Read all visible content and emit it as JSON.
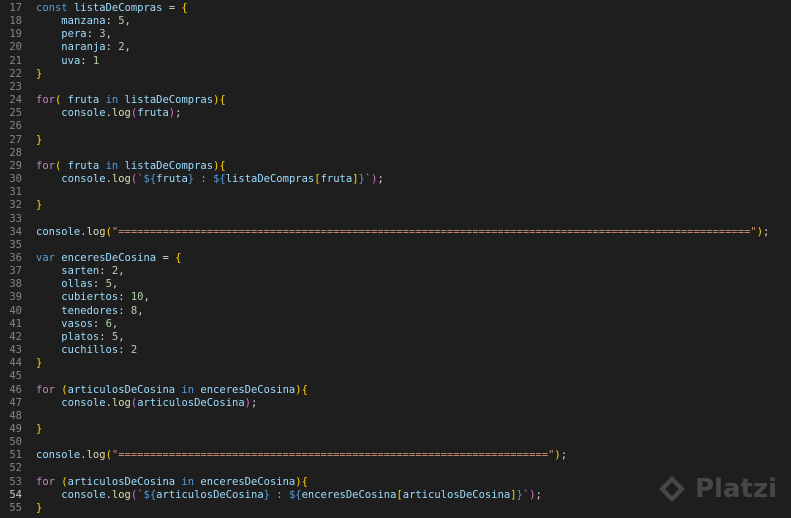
{
  "editor": {
    "active_line": 54,
    "lines": [
      {
        "n": "17",
        "tokens": [
          [
            "k-blue",
            "const "
          ],
          [
            "var",
            "listaDeCompras"
          ],
          [
            "plain",
            " = "
          ],
          [
            "b1",
            "{"
          ]
        ]
      },
      {
        "n": "18",
        "tokens": [
          [
            "plain",
            "    "
          ],
          [
            "var",
            "manzana"
          ],
          [
            "plain",
            ": "
          ],
          [
            "num",
            "5"
          ],
          [
            "plain",
            ","
          ]
        ]
      },
      {
        "n": "19",
        "tokens": [
          [
            "plain",
            "    "
          ],
          [
            "var",
            "pera"
          ],
          [
            "plain",
            ": "
          ],
          [
            "num",
            "3"
          ],
          [
            "plain",
            ","
          ]
        ]
      },
      {
        "n": "20",
        "tokens": [
          [
            "plain",
            "    "
          ],
          [
            "var",
            "naranja"
          ],
          [
            "plain",
            ": "
          ],
          [
            "num",
            "2"
          ],
          [
            "plain",
            ","
          ]
        ]
      },
      {
        "n": "21",
        "tokens": [
          [
            "plain",
            "    "
          ],
          [
            "var",
            "uva"
          ],
          [
            "plain",
            ": "
          ],
          [
            "num",
            "1"
          ]
        ]
      },
      {
        "n": "22",
        "tokens": [
          [
            "b1",
            "}"
          ]
        ]
      },
      {
        "n": "23",
        "tokens": []
      },
      {
        "n": "24",
        "tokens": [
          [
            "k-pur",
            "for"
          ],
          [
            "b1",
            "("
          ],
          [
            "plain",
            " "
          ],
          [
            "var",
            "fruta"
          ],
          [
            "plain",
            " "
          ],
          [
            "k-blue",
            "in"
          ],
          [
            "plain",
            " "
          ],
          [
            "var",
            "listaDeCompras"
          ],
          [
            "b1",
            ")"
          ],
          [
            "b1",
            "{"
          ]
        ]
      },
      {
        "n": "25",
        "tokens": [
          [
            "plain",
            "    "
          ],
          [
            "var",
            "console"
          ],
          [
            "plain",
            "."
          ],
          [
            "fn",
            "log"
          ],
          [
            "b2",
            "("
          ],
          [
            "var",
            "fruta"
          ],
          [
            "b2",
            ")"
          ],
          [
            "plain",
            ";"
          ]
        ]
      },
      {
        "n": "26",
        "tokens": []
      },
      {
        "n": "27",
        "tokens": [
          [
            "b1",
            "}"
          ]
        ]
      },
      {
        "n": "28",
        "tokens": []
      },
      {
        "n": "29",
        "tokens": [
          [
            "k-pur",
            "for"
          ],
          [
            "b1",
            "("
          ],
          [
            "plain",
            " "
          ],
          [
            "var",
            "fruta"
          ],
          [
            "plain",
            " "
          ],
          [
            "k-blue",
            "in"
          ],
          [
            "plain",
            " "
          ],
          [
            "var",
            "listaDeCompras"
          ],
          [
            "b1",
            ")"
          ],
          [
            "b1",
            "{"
          ]
        ]
      },
      {
        "n": "30",
        "tokens": [
          [
            "plain",
            "    "
          ],
          [
            "var",
            "console"
          ],
          [
            "plain",
            "."
          ],
          [
            "fn",
            "log"
          ],
          [
            "b2",
            "("
          ],
          [
            "str",
            "`"
          ],
          [
            "tmpl-i",
            "${"
          ],
          [
            "var",
            "fruta"
          ],
          [
            "tmpl-i",
            "}"
          ],
          [
            "str",
            " : "
          ],
          [
            "tmpl-i",
            "${"
          ],
          [
            "var",
            "listaDeCompras"
          ],
          [
            "b1",
            "["
          ],
          [
            "var",
            "fruta"
          ],
          [
            "b1",
            "]"
          ],
          [
            "tmpl-i",
            "}"
          ],
          [
            "str",
            "`"
          ],
          [
            "b2",
            ")"
          ],
          [
            "plain",
            ";"
          ]
        ]
      },
      {
        "n": "31",
        "tokens": []
      },
      {
        "n": "32",
        "tokens": [
          [
            "b1",
            "}"
          ]
        ]
      },
      {
        "n": "33",
        "tokens": []
      },
      {
        "n": "34",
        "tokens": [
          [
            "var",
            "console"
          ],
          [
            "plain",
            "."
          ],
          [
            "fn",
            "log"
          ],
          [
            "b1",
            "("
          ],
          [
            "str",
            "\"====================================================================================================\""
          ],
          [
            "b1",
            ")"
          ],
          [
            "plain",
            ";"
          ]
        ]
      },
      {
        "n": "35",
        "tokens": []
      },
      {
        "n": "36",
        "tokens": [
          [
            "k-blue",
            "var "
          ],
          [
            "var",
            "enceresDeCosina"
          ],
          [
            "plain",
            " = "
          ],
          [
            "b1",
            "{"
          ]
        ]
      },
      {
        "n": "37",
        "tokens": [
          [
            "plain",
            "    "
          ],
          [
            "var",
            "sarten"
          ],
          [
            "plain",
            ": "
          ],
          [
            "num",
            "2"
          ],
          [
            "plain",
            ","
          ]
        ]
      },
      {
        "n": "38",
        "tokens": [
          [
            "plain",
            "    "
          ],
          [
            "var",
            "ollas"
          ],
          [
            "plain",
            ": "
          ],
          [
            "num",
            "5"
          ],
          [
            "plain",
            ","
          ]
        ]
      },
      {
        "n": "39",
        "tokens": [
          [
            "plain",
            "    "
          ],
          [
            "var",
            "cubiertos"
          ],
          [
            "plain",
            ": "
          ],
          [
            "num",
            "10"
          ],
          [
            "plain",
            ","
          ]
        ]
      },
      {
        "n": "40",
        "tokens": [
          [
            "plain",
            "    "
          ],
          [
            "var",
            "tenedores"
          ],
          [
            "plain",
            ": "
          ],
          [
            "num",
            "8"
          ],
          [
            "plain",
            ","
          ]
        ]
      },
      {
        "n": "41",
        "tokens": [
          [
            "plain",
            "    "
          ],
          [
            "var",
            "vasos"
          ],
          [
            "plain",
            ": "
          ],
          [
            "num",
            "6"
          ],
          [
            "plain",
            ","
          ]
        ]
      },
      {
        "n": "42",
        "tokens": [
          [
            "plain",
            "    "
          ],
          [
            "var",
            "platos"
          ],
          [
            "plain",
            ": "
          ],
          [
            "num",
            "5"
          ],
          [
            "plain",
            ","
          ]
        ]
      },
      {
        "n": "43",
        "tokens": [
          [
            "plain",
            "    "
          ],
          [
            "var",
            "cuchillos"
          ],
          [
            "plain",
            ": "
          ],
          [
            "num",
            "2"
          ]
        ]
      },
      {
        "n": "44",
        "tokens": [
          [
            "b1",
            "}"
          ]
        ]
      },
      {
        "n": "45",
        "tokens": []
      },
      {
        "n": "46",
        "tokens": [
          [
            "k-pur",
            "for"
          ],
          [
            "plain",
            " "
          ],
          [
            "b1",
            "("
          ],
          [
            "var",
            "articulosDeCosina"
          ],
          [
            "plain",
            " "
          ],
          [
            "k-blue",
            "in"
          ],
          [
            "plain",
            " "
          ],
          [
            "var",
            "enceresDeCosina"
          ],
          [
            "b1",
            ")"
          ],
          [
            "b1",
            "{"
          ]
        ]
      },
      {
        "n": "47",
        "tokens": [
          [
            "plain",
            "    "
          ],
          [
            "var",
            "console"
          ],
          [
            "plain",
            "."
          ],
          [
            "fn",
            "log"
          ],
          [
            "b2",
            "("
          ],
          [
            "var",
            "articulosDeCosina"
          ],
          [
            "b2",
            ")"
          ],
          [
            "plain",
            ";"
          ]
        ]
      },
      {
        "n": "48",
        "tokens": []
      },
      {
        "n": "49",
        "tokens": [
          [
            "b1",
            "}"
          ]
        ]
      },
      {
        "n": "50",
        "tokens": []
      },
      {
        "n": "51",
        "tokens": [
          [
            "var",
            "console"
          ],
          [
            "plain",
            "."
          ],
          [
            "fn",
            "log"
          ],
          [
            "b1",
            "("
          ],
          [
            "str",
            "\"====================================================================\""
          ],
          [
            "b1",
            ")"
          ],
          [
            "plain",
            ";"
          ]
        ]
      },
      {
        "n": "52",
        "tokens": []
      },
      {
        "n": "53",
        "tokens": [
          [
            "k-pur",
            "for"
          ],
          [
            "plain",
            " "
          ],
          [
            "b1",
            "("
          ],
          [
            "var",
            "articulosDeCosina"
          ],
          [
            "plain",
            " "
          ],
          [
            "k-blue",
            "in"
          ],
          [
            "plain",
            " "
          ],
          [
            "var",
            "enceresDeCosina"
          ],
          [
            "b1",
            ")"
          ],
          [
            "b1",
            "{"
          ]
        ]
      },
      {
        "n": "54",
        "tokens": [
          [
            "plain",
            "    "
          ],
          [
            "var",
            "console"
          ],
          [
            "plain",
            "."
          ],
          [
            "fn",
            "log"
          ],
          [
            "b2",
            "("
          ],
          [
            "str",
            "`"
          ],
          [
            "tmpl-i",
            "${"
          ],
          [
            "var",
            "articulosDeCosina"
          ],
          [
            "tmpl-i",
            "}"
          ],
          [
            "str",
            " : "
          ],
          [
            "tmpl-i",
            "${"
          ],
          [
            "var",
            "enceresDeCosina"
          ],
          [
            "b1",
            "["
          ],
          [
            "var",
            "articulosDeCosina"
          ],
          [
            "b1",
            "]"
          ],
          [
            "tmpl-i",
            "}"
          ],
          [
            "str",
            "`"
          ],
          [
            "b2",
            ")"
          ],
          [
            "plain",
            ";"
          ]
        ]
      },
      {
        "n": "55",
        "tokens": [
          [
            "b1",
            "}"
          ]
        ]
      }
    ]
  },
  "watermark": {
    "text": "Platzi",
    "icon": "platzi-logo-icon"
  }
}
